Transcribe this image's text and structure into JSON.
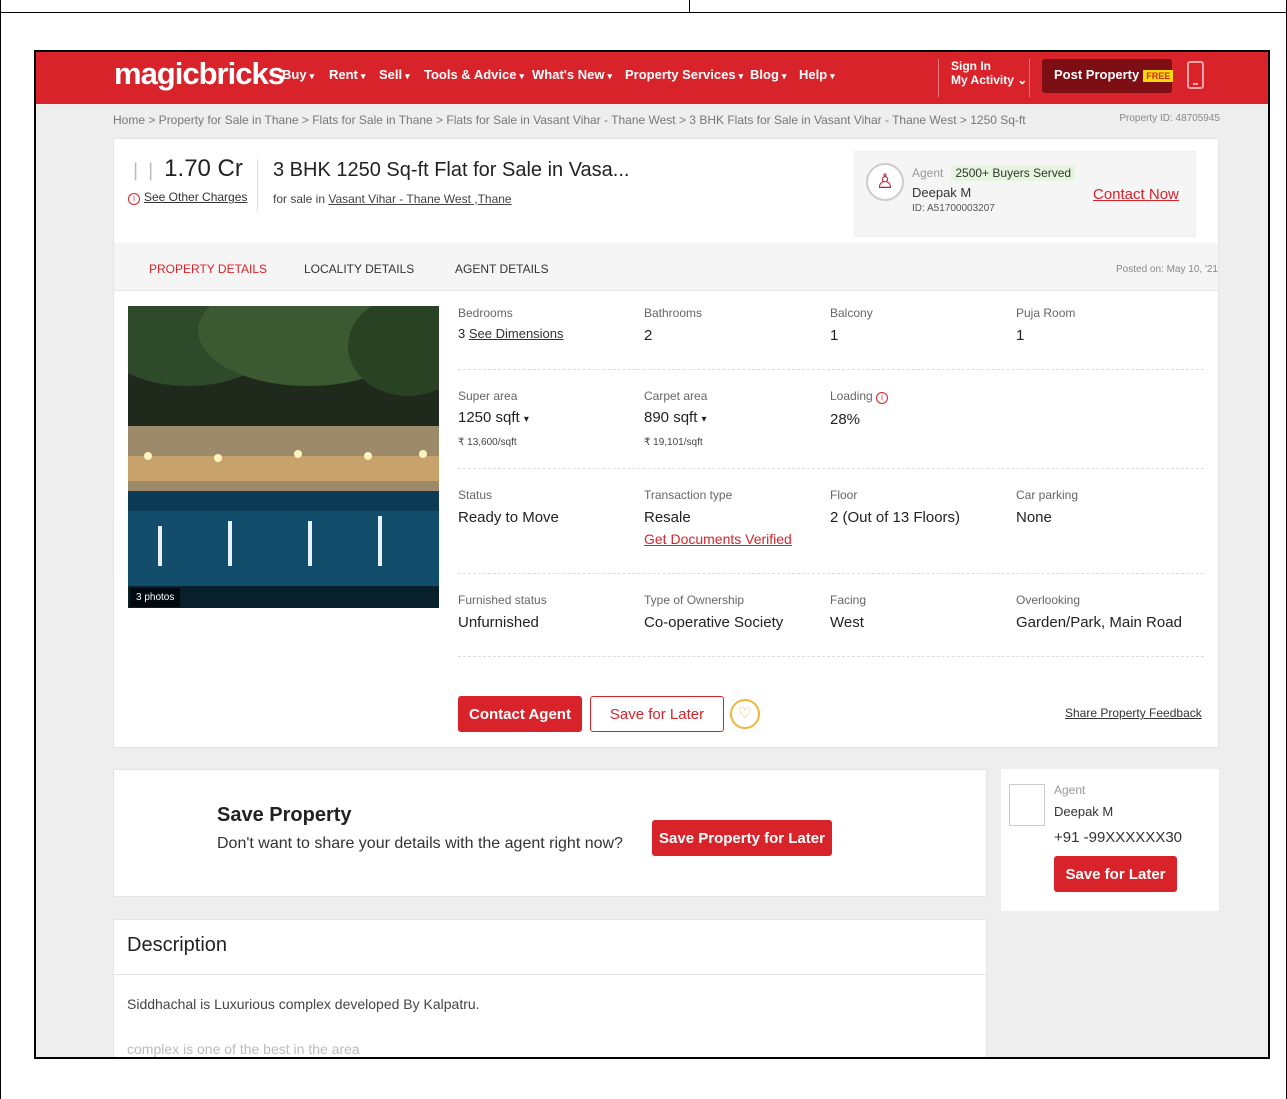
{
  "nav": {
    "logo": "magicbricks",
    "items": [
      {
        "label": "Buy"
      },
      {
        "label": "Rent"
      },
      {
        "label": "Sell"
      },
      {
        "label": "Tools & Advice"
      },
      {
        "label": "What's New"
      },
      {
        "label": "Property Services"
      },
      {
        "label": "Blog"
      },
      {
        "label": "Help"
      }
    ],
    "signin": "Sign In",
    "myactivity": "My Activity",
    "post_property": "Post Property",
    "free_badge": "FREE",
    "colors": {
      "brand": "#d8232a",
      "post_bg": "#7d0f14"
    }
  },
  "breadcrumb": "Home  >  Property for Sale in Thane  >  Flats for Sale in Thane  >  Flats for Sale in Vasant Vihar - Thane West  >  3 BHK Flats for Sale in Vasant Vihar - Thane West  > 1250 Sq-ft",
  "property_id": "Property ID: 48705945",
  "listing": {
    "price": "1.70 Cr",
    "see_other_charges": "See Other Charges",
    "title": "3 BHK 1250 Sq-ft Flat for Sale in Vasa...",
    "for_sale_prefix": "for sale in",
    "location": "Vasant Vihar - Thane West ,Thane"
  },
  "agent": {
    "label": "Agent",
    "badge": "2500+ Buyers Served",
    "name": "Deepak M",
    "id": "ID: A51700003207",
    "contact_now": "Contact Now"
  },
  "tabs": [
    {
      "label": "PROPERTY DETAILS",
      "active": true
    },
    {
      "label": "LOCALITY DETAILS",
      "active": false
    },
    {
      "label": "AGENT DETAILS",
      "active": false
    }
  ],
  "posted": "Posted on: May 10, '21",
  "photo_count": "3 photos",
  "details": {
    "bedrooms": {
      "label": "Bedrooms",
      "value": "3",
      "link": "See Dimensions"
    },
    "bathrooms": {
      "label": "Bathrooms",
      "value": "2"
    },
    "balcony": {
      "label": "Balcony",
      "value": "1"
    },
    "puja": {
      "label": "Puja Room",
      "value": "1"
    },
    "super_area": {
      "label": "Super area",
      "value": "1250 sqft",
      "sub": "₹ 13,600/sqft"
    },
    "carpet_area": {
      "label": "Carpet area",
      "value": "890 sqft",
      "sub": "₹ 19,101/sqft"
    },
    "loading": {
      "label": "Loading",
      "value": "28%"
    },
    "status": {
      "label": "Status",
      "value": "Ready to Move"
    },
    "transaction": {
      "label": "Transaction type",
      "value": "Resale",
      "link": "Get Documents Verified"
    },
    "floor": {
      "label": "Floor",
      "value": "2 (Out of 13 Floors)"
    },
    "parking": {
      "label": "Car parking",
      "value": "None"
    },
    "furnished": {
      "label": "Furnished status",
      "value": "Unfurnished"
    },
    "ownership": {
      "label": "Type of Ownership",
      "value": "Co-operative Society"
    },
    "facing": {
      "label": "Facing",
      "value": "West"
    },
    "overlooking": {
      "label": "Overlooking",
      "value": "Garden/Park, Main Road"
    }
  },
  "actions": {
    "contact_agent": "Contact Agent",
    "save_for_later": "Save for Later",
    "share_feedback": "Share Property Feedback"
  },
  "save_property": {
    "heading": "Save Property",
    "sub": "Don't want to share your details with the agent right now?",
    "button": "Save Property for Later"
  },
  "side_agent": {
    "label": "Agent",
    "name": "Deepak M",
    "phone": "+91 -99XXXXXX30",
    "button": "Save for Later"
  },
  "description": {
    "heading": "Description",
    "line1": "Siddhachal is Luxurious complex developed By Kalpatru.",
    "line2": "complex is one of the best in the area"
  }
}
